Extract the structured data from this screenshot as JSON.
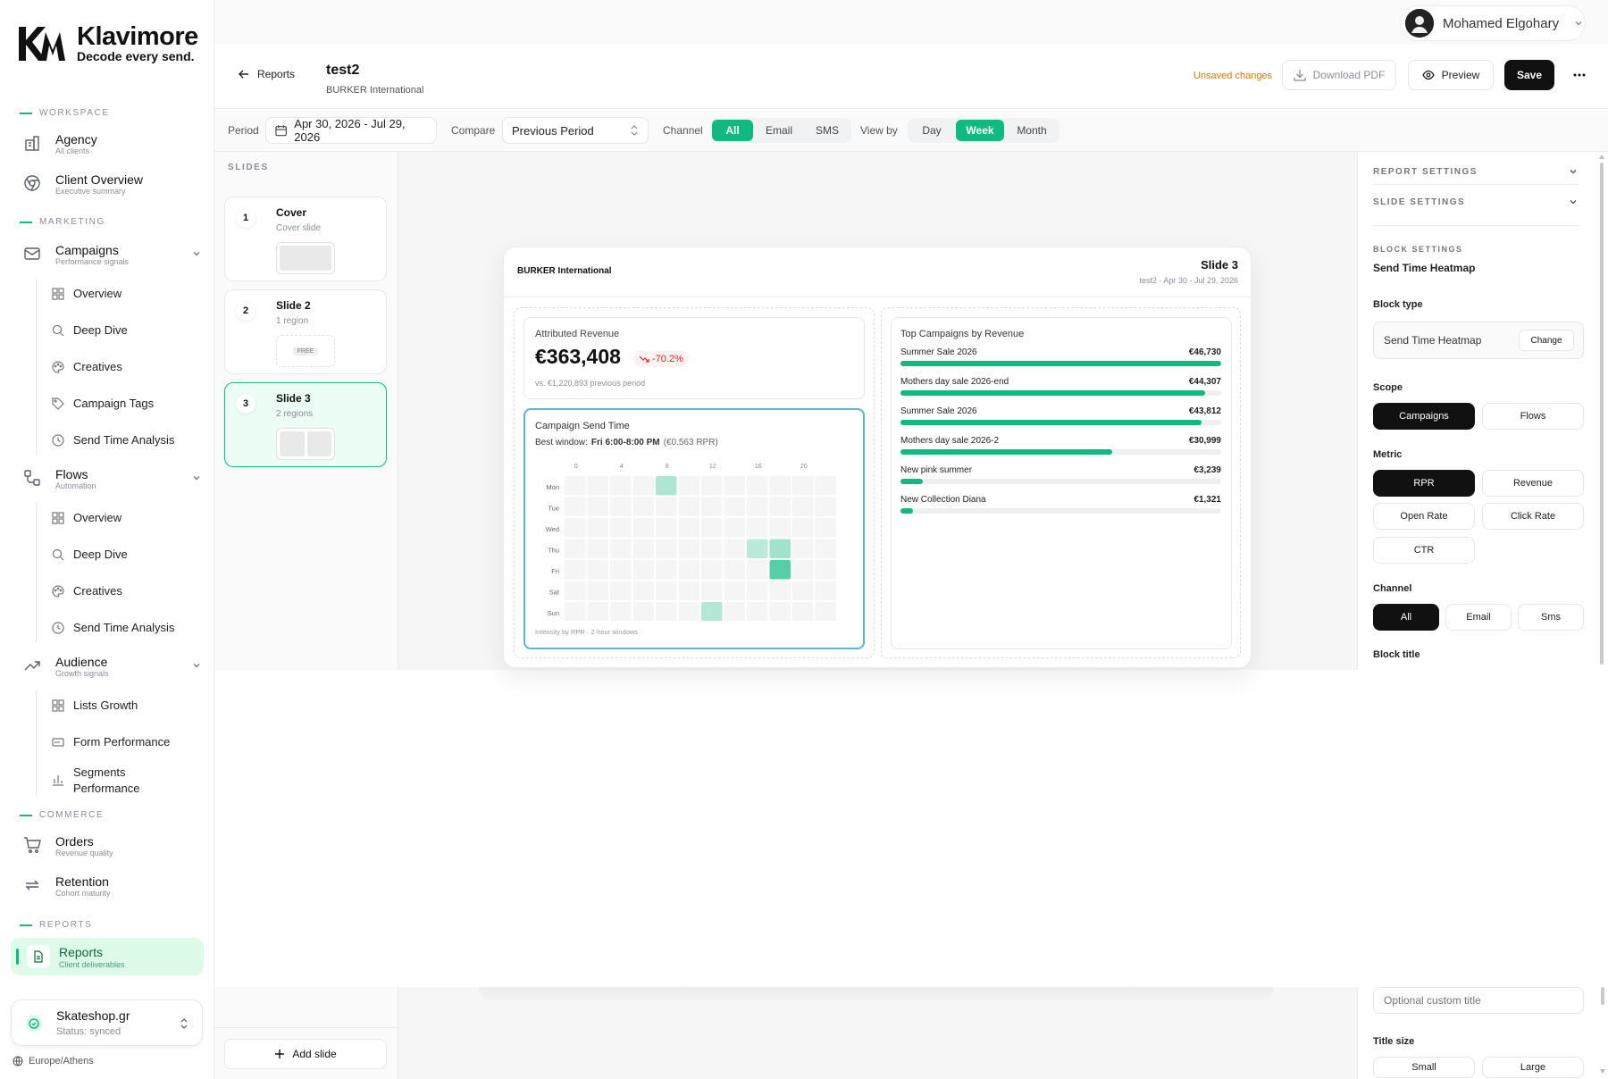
{
  "brand": {
    "name": "Klavimore",
    "tagline": "Decode every send."
  },
  "sidebar": {
    "sections": [
      "WORKSPACE",
      "MARKETING",
      "COMMERCE",
      "REPORTS"
    ],
    "agency": {
      "label": "Agency",
      "sub": "All clients"
    },
    "client_overview": {
      "label": "Client Overview",
      "sub": "Executive summary"
    },
    "campaigns": {
      "label": "Campaigns",
      "sub": "Performance signals",
      "items": [
        "Overview",
        "Deep Dive",
        "Creatives",
        "Campaign Tags",
        "Send Time Analysis"
      ]
    },
    "flows": {
      "label": "Flows",
      "sub": "Automation",
      "items": [
        "Overview",
        "Deep Dive",
        "Creatives",
        "Send Time Analysis"
      ]
    },
    "audience": {
      "label": "Audience",
      "sub": "Growth signals",
      "items": [
        "Lists Growth",
        "Form Performance",
        "Segments Performance"
      ]
    },
    "orders": {
      "label": "Orders",
      "sub": "Revenue quality"
    },
    "retention": {
      "label": "Retention",
      "sub": "Cohort maturity"
    },
    "reports": {
      "label": "Reports",
      "sub": "Client deliverables"
    },
    "account": {
      "name": "Skateshop.gr",
      "status": "Status: synced"
    },
    "timezone": "Europe/Athens"
  },
  "user": {
    "name": "Mohamed Elgohary"
  },
  "header": {
    "back": "Reports",
    "title": "test2",
    "subtitle": "BURKER International",
    "unsaved": "Unsaved changes",
    "download": "Download PDF",
    "preview": "Preview",
    "save": "Save"
  },
  "filters": {
    "period_label": "Period",
    "period_value": "Apr 30, 2026 - Jul 29, 2026",
    "compare_label": "Compare",
    "compare_value": "Previous Period",
    "channel_label": "Channel",
    "channel_options": [
      "All",
      "Email",
      "SMS"
    ],
    "channel_selected": "All",
    "view_label": "View by",
    "view_options": [
      "Day",
      "Week",
      "Month"
    ],
    "view_selected": "Week"
  },
  "slides_panel": {
    "heading": "SLIDES",
    "slides": [
      {
        "num": "1",
        "title": "Cover",
        "sub": "Cover slide"
      },
      {
        "num": "2",
        "title": "Slide 2",
        "sub": "1 region",
        "badge": "FREE"
      },
      {
        "num": "3",
        "title": "Slide 3",
        "sub": "2 regions"
      }
    ],
    "add": "Add slide"
  },
  "slide": {
    "company": "BURKER International",
    "title": "Slide 3",
    "meta": "test2 · Apr 30 - Jul 29, 2026",
    "revenue": {
      "title": "Attributed Revenue",
      "value": "€363,408",
      "delta": "-70.2%",
      "compare": "vs. €1,220,893 previous period"
    },
    "send_time": {
      "title": "Campaign Send Time",
      "best_prefix": "Best window:",
      "best_value": "Fri 6:00-8:00 PM",
      "best_rpr": "(€0.563 RPR)",
      "hours": [
        "0",
        "4",
        "8",
        "12",
        "16",
        "20"
      ],
      "days": [
        "Mon",
        "Tue",
        "Wed",
        "Thu",
        "Fri",
        "Sat",
        "Sun"
      ],
      "footnote": "Intensity by RPR · 2-hour windows",
      "hot_cells": [
        {
          "day": "Mon",
          "slot": 4,
          "level": 0.35
        },
        {
          "day": "Thu",
          "slot": 8,
          "level": 0.25
        },
        {
          "day": "Thu",
          "slot": 9,
          "level": 0.45
        },
        {
          "day": "Fri",
          "slot": 9,
          "level": 1.0
        },
        {
          "day": "Sun",
          "slot": 6,
          "level": 0.3
        }
      ]
    },
    "top_campaigns": {
      "title": "Top Campaigns by Revenue",
      "items": [
        {
          "name": "Summer Sale 2026",
          "value": "€46,730",
          "share": 1.0
        },
        {
          "name": "Mothers day sale 2026-end",
          "value": "€44,307",
          "share": 0.95
        },
        {
          "name": "Summer Sale 2026",
          "value": "€43,812",
          "share": 0.94
        },
        {
          "name": "Mothers day sale 2026-2",
          "value": "€30,999",
          "share": 0.66
        },
        {
          "name": "New pink summer",
          "value": "€3,239",
          "share": 0.07
        },
        {
          "name": "New Collection Diana",
          "value": "€1,321",
          "share": 0.04
        }
      ]
    }
  },
  "settings": {
    "report_settings": "REPORT SETTINGS",
    "slide_settings": "SLIDE SETTINGS",
    "block_settings": "BLOCK SETTINGS",
    "block_name": "Send Time Heatmap",
    "block_type_label": "Block type",
    "block_type_value": "Send Time Heatmap",
    "change": "Change",
    "scope_label": "Scope",
    "scope_options": [
      "Campaigns",
      "Flows"
    ],
    "metric_label": "Metric",
    "metric_options": [
      "RPR",
      "Revenue",
      "Open Rate",
      "Click Rate",
      "CTR"
    ],
    "channel_label": "Channel",
    "channel_options": [
      "All",
      "Email",
      "Sms"
    ],
    "block_title_label": "Block title",
    "block_title_placeholder": "Optional custom title",
    "title_size_label": "Title size",
    "title_size_options": [
      "Small",
      "Large"
    ]
  },
  "colors": {
    "accent": "#10b981",
    "warning": "#d97706",
    "negative": "#dc2626",
    "dark": "#111111"
  }
}
